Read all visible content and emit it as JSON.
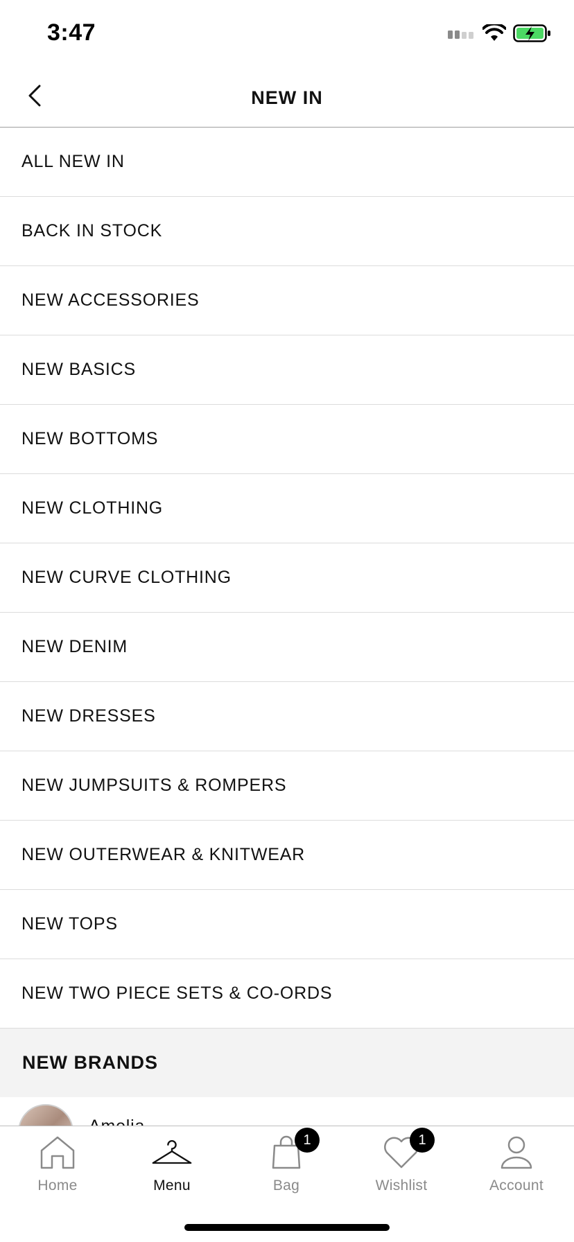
{
  "status_bar": {
    "time": "3:47"
  },
  "header": {
    "title": "NEW IN"
  },
  "menu": {
    "items": [
      {
        "label": "ALL NEW IN"
      },
      {
        "label": "BACK IN STOCK"
      },
      {
        "label": "NEW ACCESSORIES"
      },
      {
        "label": "NEW BASICS"
      },
      {
        "label": "NEW BOTTOMS"
      },
      {
        "label": "NEW CLOTHING"
      },
      {
        "label": "NEW CURVE CLOTHING"
      },
      {
        "label": "NEW DENIM"
      },
      {
        "label": "NEW DRESSES"
      },
      {
        "label": "NEW JUMPSUITS & ROMPERS"
      },
      {
        "label": "NEW OUTERWEAR & KNITWEAR"
      },
      {
        "label": "NEW TOPS"
      },
      {
        "label": "NEW TWO PIECE SETS & CO-ORDS"
      }
    ]
  },
  "brands_section": {
    "title": "NEW BRANDS",
    "first_brand": "Amelia"
  },
  "tab_bar": {
    "tabs": [
      {
        "label": "Home",
        "icon": "home-icon",
        "active": false
      },
      {
        "label": "Menu",
        "icon": "hanger-icon",
        "active": true
      },
      {
        "label": "Bag",
        "icon": "bag-icon",
        "active": false,
        "badge": "1"
      },
      {
        "label": "Wishlist",
        "icon": "heart-icon",
        "active": false,
        "badge": "1"
      },
      {
        "label": "Account",
        "icon": "person-icon",
        "active": false
      }
    ]
  },
  "colors": {
    "battery_fill": "#4cd964",
    "badge_bg": "#000000",
    "inactive_tab": "#8a8a8a",
    "section_bg": "#f3f3f3"
  }
}
